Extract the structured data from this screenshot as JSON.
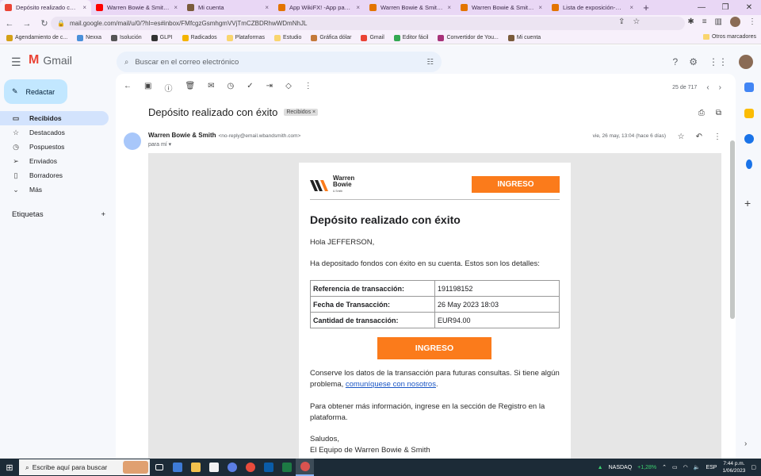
{
  "tabs": [
    {
      "title": "Depósito realizado con éxito",
      "color": "#ea4335",
      "active": true
    },
    {
      "title": "Warren Bowie & Smith lo...",
      "color": "#ff0000"
    },
    {
      "title": "Mi cuenta",
      "color": "#7a5b3b"
    },
    {
      "title": "App WikiFX! -App para co...",
      "color": "#e37400"
    },
    {
      "title": "Warren Bowie & Smith - ...",
      "color": "#e37400"
    },
    {
      "title": "Warren Bowie & Smith Co...",
      "color": "#e37400"
    },
    {
      "title": "Lista de exposición-Global",
      "color": "#e37400"
    }
  ],
  "address": {
    "url": "mail.google.com/mail/u/0/?hl=es#inbox/FMfcgzGsmhgmVVjTmCZBDRhwWDmNhJL"
  },
  "bookmarks": [
    {
      "label": "Agendamiento de c...",
      "color": "#d4a017"
    },
    {
      "label": "Nexxa",
      "color": "#4a90d9"
    },
    {
      "label": "Isolución",
      "color": "#555555"
    },
    {
      "label": "GLPI",
      "color": "#333333"
    },
    {
      "label": "Radicados",
      "color": "#f4b400"
    },
    {
      "label": "Plataformas",
      "color": "#f9d56e"
    },
    {
      "label": "Estudio",
      "color": "#f9d56e"
    },
    {
      "label": "Gráfica dólar",
      "color": "#c47a3a"
    },
    {
      "label": "Gmail",
      "color": "#ea4335"
    },
    {
      "label": "Editor fácil",
      "color": "#34a853"
    },
    {
      "label": "Convertidor de You...",
      "color": "#a83279"
    },
    {
      "label": "Mi cuenta",
      "color": "#7a5b3b"
    }
  ],
  "bookmarks_other": "Otros marcadores",
  "gmail": {
    "logo": "Gmail",
    "search_placeholder": "Buscar en el correo electrónico",
    "compose": "Redactar",
    "nav": [
      {
        "label": "Recibidos",
        "icon": "inbox-icon",
        "glyph": "▭",
        "active": true
      },
      {
        "label": "Destacados",
        "icon": "star-icon",
        "glyph": "☆"
      },
      {
        "label": "Pospuestos",
        "icon": "clock-icon",
        "glyph": "◷"
      },
      {
        "label": "Enviados",
        "icon": "send-icon",
        "glyph": "➢"
      },
      {
        "label": "Borradores",
        "icon": "draft-icon",
        "glyph": "▯"
      },
      {
        "label": "Más",
        "icon": "chevron-down-icon",
        "glyph": "⌄"
      }
    ],
    "labels_title": "Etiquetas",
    "pager": "25 de 717"
  },
  "message": {
    "subject": "Depósito realizado con éxito",
    "label": "Recibidos ×",
    "sender_name": "Warren Bowie & Smith",
    "sender_email": "<no-reply@email.wbandsmith.com>",
    "to": "para mí ▾",
    "date": "vie, 26 may, 13:04 (hace 6 días)"
  },
  "email": {
    "brand_line1": "Warren",
    "brand_line2": "Bowie",
    "brand_small": "& Smith",
    "top_button": "INGRESO",
    "heading": "Depósito realizado con éxito",
    "greeting": "Hola JEFFERSON,",
    "intro": "Ha depositado fondos con éxito en su cuenta. Estos son los detalles:",
    "rows": [
      {
        "key": "Referencia de transacción:",
        "value": "191198152"
      },
      {
        "key": "Fecha de Transacción:",
        "value": "26 May 2023 18:03"
      },
      {
        "key": "Cantidad de transacción:",
        "value": "EUR94.00"
      }
    ],
    "mid_button": "INGRESO",
    "keep_text": "Conserve los datos de la transacción para futuras consultas. Si tiene algún problema,",
    "keep_link": "comuníquese con nosotros",
    "more_info": "Para obtener más información, ingrese en la sección de Registro en la plataforma.",
    "regards": "Saludos,",
    "signature": "El Equipo de Warren Bowie & Smith"
  },
  "taskbar": {
    "search": "Escribe aquí para buscar",
    "ticker": "NASDAQ",
    "ticker_change": "+1,28%",
    "lang": "ESP",
    "time": "7:44 p.m.",
    "date": "1/06/2023"
  },
  "colors": {
    "accent_orange": "#fb7b1b",
    "link": "#1a56c5"
  }
}
